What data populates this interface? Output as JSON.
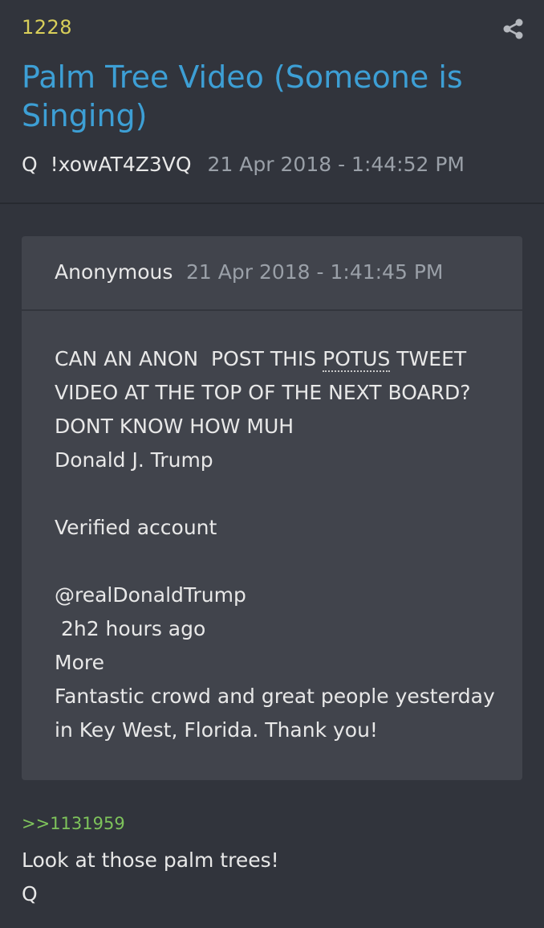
{
  "post": {
    "number": "1228",
    "title": "Palm Tree Video (Someone is Singing)",
    "author": "Q",
    "tripcode": "!xowAT4Z3VQ",
    "timestamp": "21 Apr 2018 - 1:44:52 PM",
    "share_icon": "share-icon"
  },
  "quoted": {
    "author": "Anonymous",
    "timestamp": "21 Apr 2018 - 1:41:45 PM",
    "line1_prefix": "CAN AN ANON  POST THIS ",
    "line1_abbr": "POTUS",
    "line1_suffix": " TWEET",
    "lines": [
      "VIDEO AT THE TOP OF THE NEXT BOARD?",
      "DONT KNOW HOW MUH",
      "Donald J. Trump",
      "",
      "Verified account",
      "",
      "@realDonaldTrump",
      " 2h2 hours ago",
      "More",
      "Fantastic crowd and great people yesterday",
      "in Key West, Florida. Thank you!"
    ]
  },
  "reply": {
    "link": ">>1131959",
    "lines": [
      "Look at those palm trees!",
      "Q"
    ]
  },
  "colors": {
    "background": "#31343c",
    "card": "#41444c",
    "title": "#3d9fd5",
    "post_number": "#d9cf5a",
    "reply_link": "#7ec35b",
    "muted": "#9aa0a8"
  }
}
